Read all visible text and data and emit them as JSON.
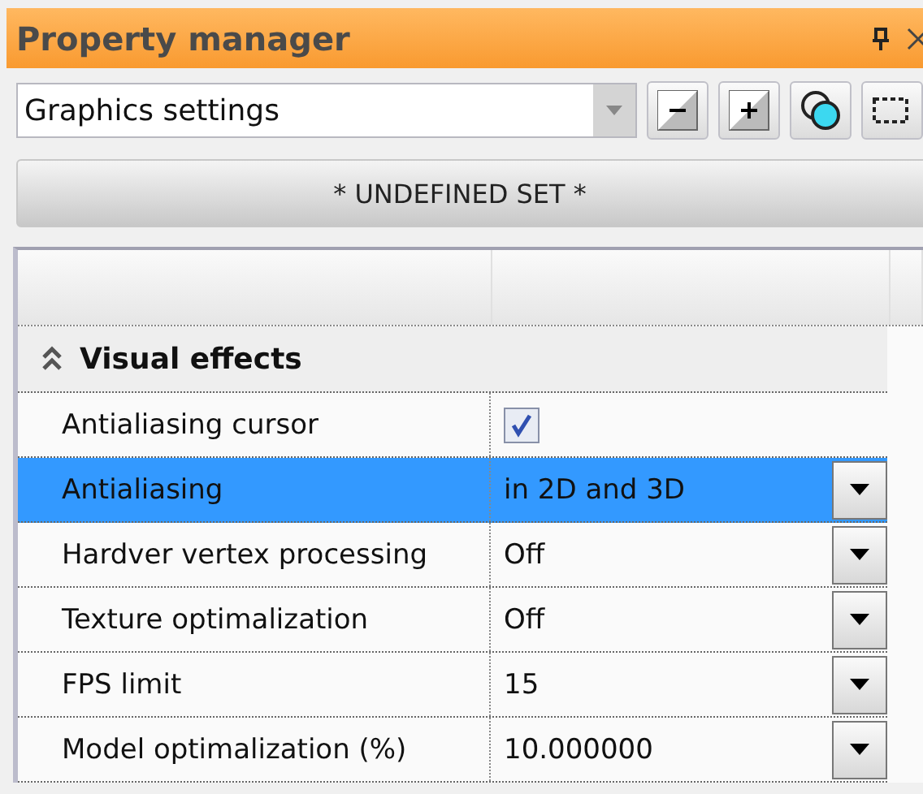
{
  "window": {
    "title": "Property manager"
  },
  "preset_dropdown": {
    "value": "Graphics settings"
  },
  "set_button": {
    "label": "* UNDEFINED SET *"
  },
  "section": {
    "title": "Visual effects",
    "expanded": true
  },
  "properties": [
    {
      "name": "Antialiasing cursor",
      "kind": "checkbox",
      "checked": true,
      "selected": false
    },
    {
      "name": "Antialiasing",
      "kind": "dropdown",
      "value": "in 2D and 3D",
      "selected": true
    },
    {
      "name": "Hardver vertex processing",
      "kind": "dropdown",
      "value": "Off",
      "selected": false
    },
    {
      "name": "Texture optimalization",
      "kind": "dropdown",
      "value": "Off",
      "selected": false
    },
    {
      "name": "FPS limit",
      "kind": "dropdown",
      "value": "15",
      "selected": false
    },
    {
      "name": "Model optimalization (%)",
      "kind": "dropdown",
      "value": "10.000000",
      "selected": false
    }
  ]
}
